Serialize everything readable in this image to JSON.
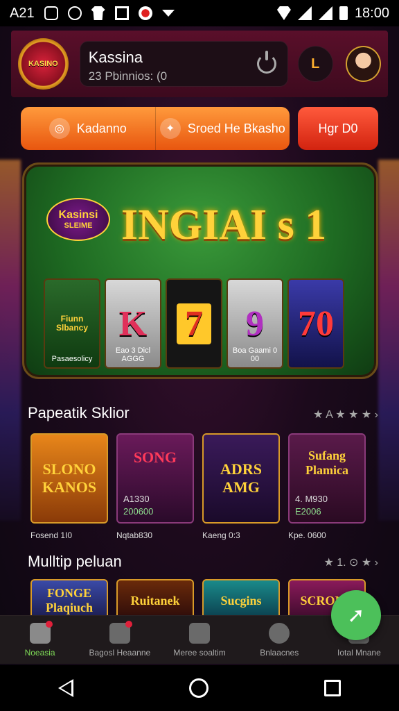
{
  "statusbar": {
    "carrier": "A21",
    "time": "18:00",
    "icons": [
      "messages-icon",
      "alarm-icon",
      "shirt-icon",
      "photo-icon",
      "game-icon",
      "dropdown-icon",
      "wifi-icon",
      "signal-icon",
      "signal2-icon",
      "battery-icon"
    ]
  },
  "header": {
    "logo_text": "KASINO",
    "name": "Kassina",
    "points": "23 Pbinnios: (0",
    "coin_label": "L"
  },
  "actions": {
    "left_label": "Kadanno",
    "middle_label": "Sroed He Bkasho",
    "right_label": "Hgr D0"
  },
  "banner": {
    "title": "INGIAI s 1",
    "badge_line1": "Kasinsi",
    "badge_line2": "SLEIME",
    "reel1_top": "Fiunn Slbancy",
    "reel1_cap": "Pasaesolicy",
    "reel2_sym": "K",
    "reel2_cap": "Eao 3 Dicl AGGG",
    "reel3_sym": "7",
    "reel4_sym": "9",
    "reel4_cap": "Boa Gaami 0 00",
    "reel5_sym": "70"
  },
  "section1": {
    "title": "Papeatik Sklior",
    "right": "★ A ★ ★ ★  ›"
  },
  "games1": [
    {
      "title": "SLONO KANOS",
      "sub": "",
      "sub2": "",
      "cap": "Fosend 1I0"
    },
    {
      "title": "SONG",
      "sub": "A1330",
      "sub2": "200600",
      "cap": "Nqtab830"
    },
    {
      "title": "ADRS AMG",
      "sub": "",
      "sub2": "",
      "cap": "Kaeng 0:3"
    },
    {
      "title": "Sufang Plamica",
      "sub": "4. M930",
      "sub2": "E2006",
      "cap": "Kpe. 0600"
    }
  ],
  "section2": {
    "title": "Mulltip peluan",
    "right": "★ 1. ⊙ ★  ›"
  },
  "games2": [
    {
      "title": "FONGE Plaqiuch"
    },
    {
      "title": "Ruitanek"
    },
    {
      "title": "Sucgins"
    },
    {
      "title": "SCRONG"
    }
  ],
  "bottomnav": [
    {
      "label": "Noeasia",
      "active": true,
      "dot": true
    },
    {
      "label": "Bagosl Heaanne",
      "active": false,
      "dot": true
    },
    {
      "label": "Meree soaltim",
      "active": false,
      "dot": false
    },
    {
      "label": "Bnlaacnes",
      "active": false,
      "dot": false
    },
    {
      "label": "Iotal Mnane",
      "active": false,
      "dot": false
    }
  ],
  "fab_label": "➚"
}
